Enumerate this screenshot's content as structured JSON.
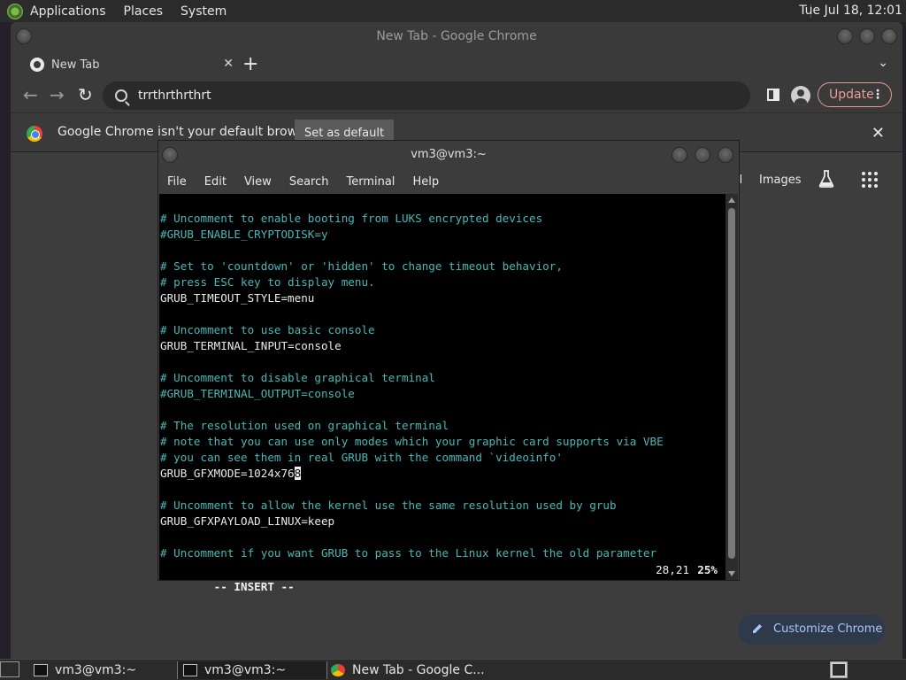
{
  "top_panel": {
    "menus": [
      "Applications",
      "Places",
      "System"
    ],
    "clock": "Tue Jul 18, 12:01"
  },
  "chrome": {
    "window_title": "New Tab - Google Chrome",
    "tab": {
      "title": "New Tab",
      "close": "✕"
    },
    "new_tab": "+",
    "tab_menu": "⌄",
    "omnibox_value": "trrthrthrthrt",
    "update_label": "Update",
    "infobar": {
      "message": "Google Chrome isn't your default browser",
      "button": "Set as default",
      "close": "✕"
    },
    "ntp": {
      "gmail_fragment": "il",
      "images": "Images",
      "customize": "Customize Chrome"
    }
  },
  "terminal": {
    "title": "vm3@vm3:~",
    "menu": [
      "File",
      "Edit",
      "View",
      "Search",
      "Terminal",
      "Help"
    ],
    "lines": [
      {
        "text": "# Uncomment to enable booting from LUKS encrypted devices",
        "kind": "comment"
      },
      {
        "text": "#GRUB_ENABLE_CRYPTODISK=y",
        "kind": "comment"
      },
      {
        "text": "",
        "kind": "normal"
      },
      {
        "text": "# Set to 'countdown' or 'hidden' to change timeout behavior,",
        "kind": "comment"
      },
      {
        "text": "# press ESC key to display menu.",
        "kind": "comment"
      },
      {
        "text": "GRUB_TIMEOUT_STYLE=menu",
        "kind": "normal"
      },
      {
        "text": "",
        "kind": "normal"
      },
      {
        "text": "# Uncomment to use basic console",
        "kind": "comment"
      },
      {
        "text": "GRUB_TERMINAL_INPUT=console",
        "kind": "normal"
      },
      {
        "text": "",
        "kind": "normal"
      },
      {
        "text": "# Uncomment to disable graphical terminal",
        "kind": "comment"
      },
      {
        "text": "#GRUB_TERMINAL_OUTPUT=console",
        "kind": "comment"
      },
      {
        "text": "",
        "kind": "normal"
      },
      {
        "text": "# The resolution used on graphical terminal",
        "kind": "comment"
      },
      {
        "text": "# note that you can use only modes which your graphic card supports via VBE",
        "kind": "comment"
      },
      {
        "text": "# you can see them in real GRUB with the command `videoinfo'",
        "kind": "comment"
      },
      {
        "text": "GRUB_GFXMODE=1024x768",
        "kind": "normal",
        "cursor_col": 20
      },
      {
        "text": "",
        "kind": "normal"
      },
      {
        "text": "# Uncomment to allow the kernel use the same resolution used by grub",
        "kind": "comment"
      },
      {
        "text": "GRUB_GFXPAYLOAD_LINUX=keep",
        "kind": "normal"
      },
      {
        "text": "",
        "kind": "normal"
      },
      {
        "text": "# Uncomment if you want GRUB to pass to the Linux kernel the old parameter",
        "kind": "comment"
      }
    ],
    "status": {
      "mode": "-- INSERT --",
      "position": "28,21",
      "percent": "25%"
    }
  },
  "taskbar": {
    "items": [
      "vm3@vm3:~",
      "vm3@vm3:~",
      "New Tab - Google C..."
    ]
  }
}
